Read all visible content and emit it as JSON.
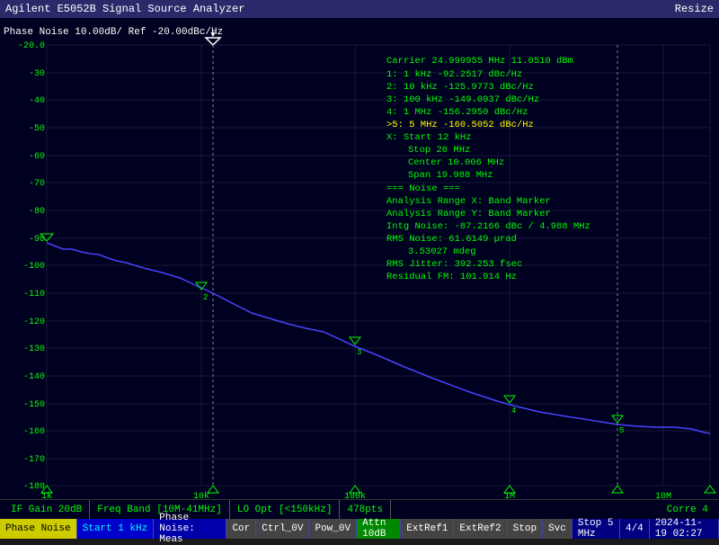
{
  "titleBar": {
    "title": "Agilent E5052B Signal Source Analyzer",
    "resizeLabel": "Resize"
  },
  "chartTitle": "Phase Noise  10.00dB/ Ref -20.00dBc/Hz",
  "carrier": {
    "label": "Carrier",
    "freq": "24.999955 MHz",
    "power": "11.0510 dBm"
  },
  "markers": [
    {
      "num": "1:",
      "freq": "  1 kHz",
      "value": "  -92.2517  dBc/Hz"
    },
    {
      "num": "2:",
      "freq": " 10 kHz",
      "value": " -125.9773  dBc/Hz"
    },
    {
      "num": "3:",
      "freq": "100 kHz",
      "value": " -149.0937  dBc/Hz"
    },
    {
      "num": "4:",
      "freq": "  1 MHz",
      "value": " -156.2950  dBc/Hz"
    },
    {
      "num": ">5:",
      "freq": "  5 MHz",
      "value": " -160.5052  dBc/Hz"
    }
  ],
  "xMarker": {
    "label": "X:",
    "start": "Start 12 kHz",
    "stop": "Stop 20 MHz",
    "center": "Center 10.006 MHz",
    "span": "Span 19.988 MHz"
  },
  "noiseSection": {
    "title": "=== Noise ===",
    "analysisX": "Analysis Range X: Band Marker",
    "analysisY": "Analysis Range Y: Band Marker",
    "intgNoise": "Intg Noise: -87.2166 dBc / 4.988 MHz",
    "rmsNoise": "RMS Noise: 61.6149 µrad",
    "rmsDeg": "            3.53027 mdeg",
    "rmsJitter": "RMS Jitter: 392.253 fsec",
    "residualFM": "Residual FM: 101.914 Hz"
  },
  "yAxis": {
    "labels": [
      "-20.0",
      "-30",
      "-40",
      "-50",
      "-60",
      "-70",
      "-80",
      "-90",
      "-100",
      "-110",
      "-120",
      "-130",
      "-140",
      "-150",
      "-160",
      "-170",
      "-180"
    ]
  },
  "statusBar": {
    "ifGain": "IF Gain 20dB",
    "freqBand": "Freq Band [10M-41MHz]",
    "loOpt": "LO Opt [<150kHz]",
    "pts": "478pts",
    "corre": "Corre 4"
  },
  "toolbar": {
    "phaseNoise": "Phase Noise",
    "start": "Start 1 kHz",
    "meas": "Phase Noise: Meas",
    "cor": "Cor",
    "ctrl": "Ctrl_0V",
    "pow": "Pow_0V",
    "attn": "Attn 10dB",
    "extRef1": "ExtRef1",
    "extRef2": "ExtRef2",
    "stop": "Stop",
    "svc": "Svc",
    "stopFreq": "Stop 5 MHz",
    "fraction": "4/4",
    "datetime": "2024-11-19 02:27"
  }
}
